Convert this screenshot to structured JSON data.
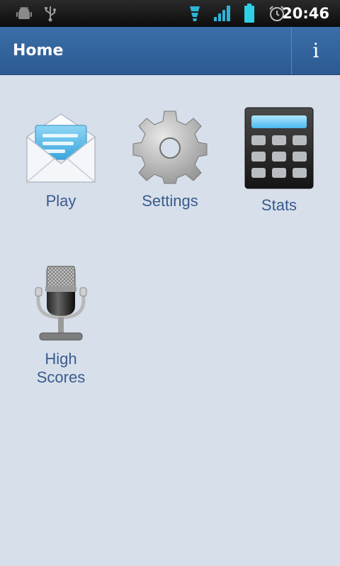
{
  "status_bar": {
    "time": "20:46",
    "icons": [
      "android-debug-icon",
      "usb-icon",
      "data-activity-icon",
      "signal-icon",
      "battery-icon",
      "alarm-icon"
    ]
  },
  "action_bar": {
    "title": "Home",
    "info_label": "i"
  },
  "tiles": [
    {
      "label": "Play",
      "icon": "envelope-icon"
    },
    {
      "label": "Settings",
      "icon": "gear-icon"
    },
    {
      "label": "Stats",
      "icon": "calculator-icon"
    },
    {
      "label": "High\nScores",
      "icon": "microphone-icon"
    }
  ],
  "colors": {
    "background": "#d7dfeb",
    "action_bar": "#2f5f98",
    "label": "#3a5b8d"
  }
}
